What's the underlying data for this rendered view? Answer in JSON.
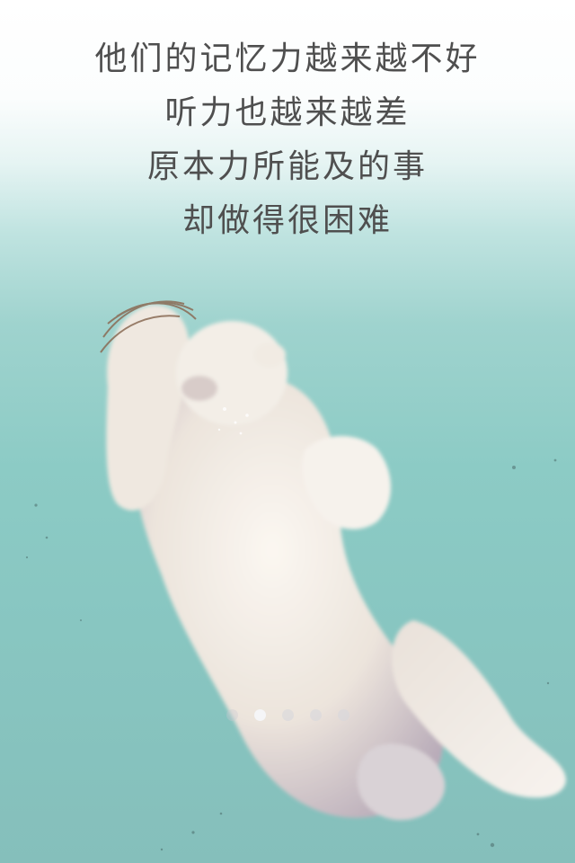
{
  "caption": {
    "lines": [
      "他们的记忆力越来越不好",
      "听力也越来越差",
      "原本力所能及的事",
      "却做得很困难"
    ]
  },
  "illustration": {
    "subject": "polar-bear-swimming-underwater",
    "colors": {
      "water_top": "#ffffff",
      "water": "#8ccbc5",
      "fur": "#f4efe8",
      "fur_shadow": "#b7a9b4"
    }
  },
  "pagination": {
    "total": 5,
    "active_index": 1
  }
}
